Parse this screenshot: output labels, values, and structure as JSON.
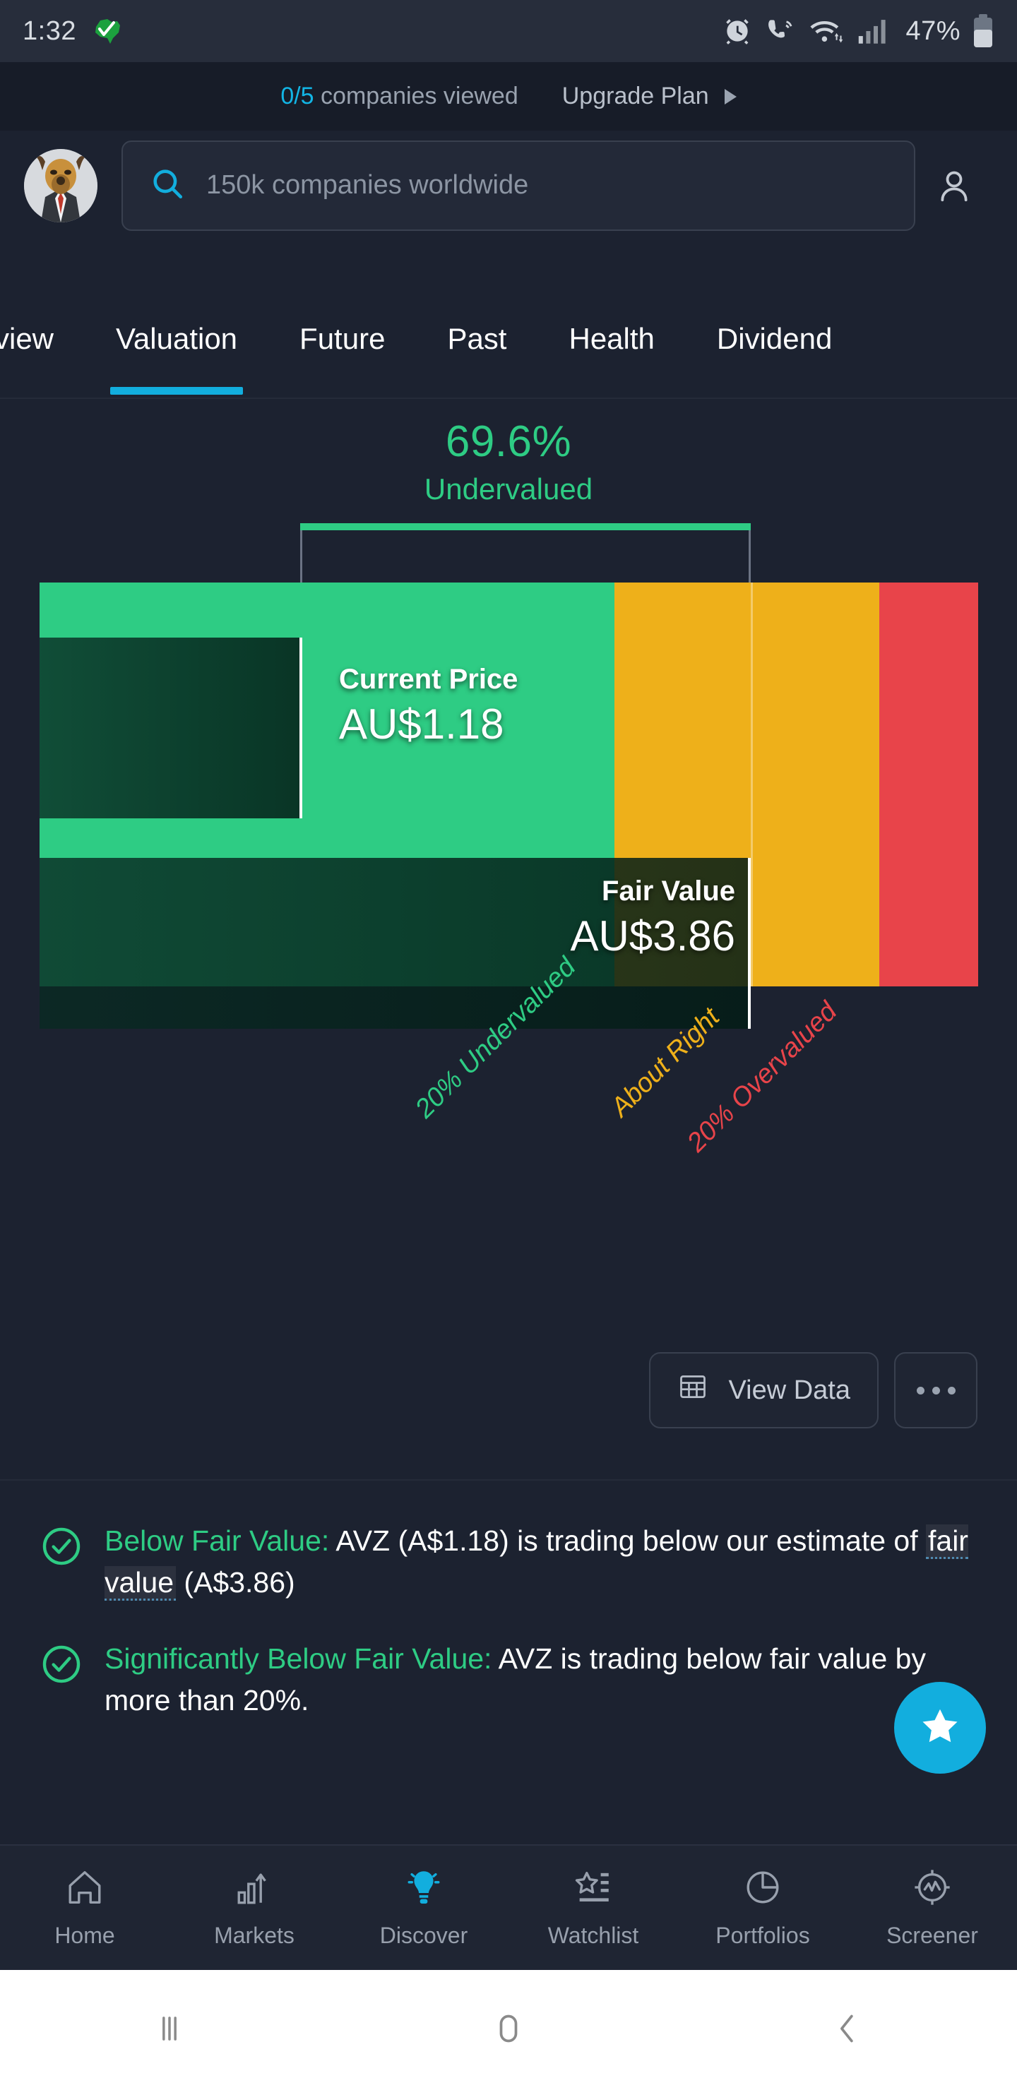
{
  "status_bar": {
    "time": "1:32",
    "app_icon": "australia-map-tick-icon",
    "icons": [
      "alarm-clock-icon",
      "wifi-calling-icon",
      "wifi-icon",
      "signal-bars-icon"
    ],
    "battery_percent": "47%",
    "battery_icon": "battery-icon"
  },
  "banner": {
    "count": "0/5",
    "count_suffix": " companies viewed",
    "upgrade_label": "Upgrade Plan",
    "arrow_icon": "play-triangle-icon",
    "accent_color": "#12b5e5"
  },
  "header": {
    "avatar": "bull-mascot-avatar",
    "search_icon": "search-icon",
    "search_value": "",
    "search_placeholder": "150k companies worldwide",
    "profile_icon": "person-icon"
  },
  "tabs": {
    "items": [
      {
        "label": "rview",
        "active": false
      },
      {
        "label": "Valuation",
        "active": true
      },
      {
        "label": "Future",
        "active": false
      },
      {
        "label": "Past",
        "active": false
      },
      {
        "label": "Health",
        "active": false
      },
      {
        "label": "Dividend",
        "active": false
      }
    ],
    "active_underline_color": "#12aede"
  },
  "chart_data": {
    "type": "bar",
    "title": "69.6%",
    "subtitle": "Undervalued",
    "orientation": "horizontal",
    "categories": [
      "Current Price",
      "Fair Value"
    ],
    "values": [
      1.18,
      3.86
    ],
    "value_labels": [
      "AU$1.18",
      "AU$3.86"
    ],
    "currency": "AU$",
    "xlabel": "",
    "ylabel": "",
    "annotations": [
      {
        "label": "20% Undervalued",
        "color": "#2ecc84"
      },
      {
        "label": "About Right",
        "color": "#eeb01a"
      },
      {
        "label": "20% Overvalued",
        "color": "#e8444a"
      }
    ],
    "zones": [
      {
        "name": "Undervalued",
        "color": "#2ecc84"
      },
      {
        "name": "About Right",
        "color": "#eeb01a"
      },
      {
        "name": "Overvalued",
        "color": "#e8444a"
      }
    ],
    "discount_percent": 69.6,
    "grid": false,
    "legend": "none"
  },
  "chart": {
    "percent": "69.6%",
    "verdict": "Undervalued",
    "current_price_caption": "Current Price",
    "current_price_value": "AU$1.18",
    "fair_value_caption": "Fair Value",
    "fair_value_value": "AU$3.86",
    "axis_undervalued": "20% Undervalued",
    "axis_about_right": "About Right",
    "axis_overvalued": "20% Overvalued"
  },
  "actions": {
    "view_data_label": "View Data",
    "view_data_icon": "table-grid-icon",
    "more_icon": "ellipsis-icon"
  },
  "checklist": [
    {
      "icon": "check-circle-icon",
      "highlight": "Below Fair Value:",
      "rest_a": " AVZ (A$1.18) is trading below our estimate of ",
      "tooltip_term": "fair value",
      "rest_b": " (A$3.86)"
    },
    {
      "icon": "check-circle-icon",
      "highlight": "Significantly Below Fair Value:",
      "rest_a": " AVZ is trading below fair value by more than 20%.",
      "tooltip_term": "",
      "rest_b": ""
    }
  ],
  "fab": {
    "icon": "star-icon",
    "color": "#12aede"
  },
  "bottom_nav": {
    "items": [
      {
        "label": "Home",
        "icon": "home-icon",
        "active": false
      },
      {
        "label": "Markets",
        "icon": "bar-chart-arrow-icon",
        "active": false
      },
      {
        "label": "Discover",
        "icon": "lightbulb-icon",
        "active": true
      },
      {
        "label": "Watchlist",
        "icon": "star-list-icon",
        "active": false
      },
      {
        "label": "Portfolios",
        "icon": "pie-chart-icon",
        "active": false
      },
      {
        "label": "Screener",
        "icon": "compass-chart-icon",
        "active": false
      }
    ],
    "active_color": "#12aede"
  },
  "system_nav": {
    "recents_icon": "recents-icon",
    "home_icon": "home-pill-icon",
    "back_icon": "back-chevron-icon"
  }
}
